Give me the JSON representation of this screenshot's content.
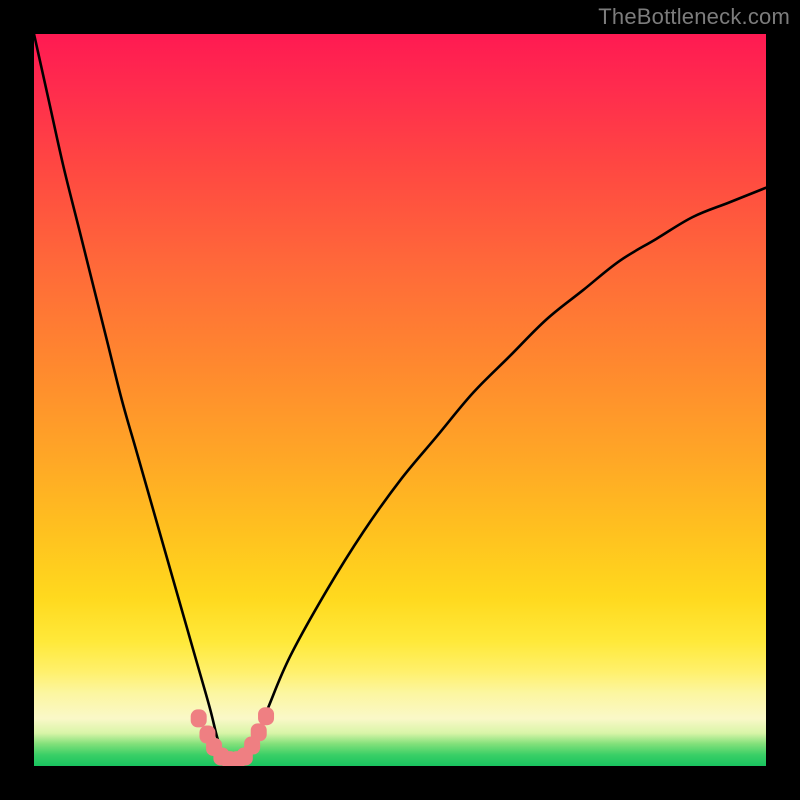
{
  "watermark": {
    "text": "TheBottleneck.com"
  },
  "chart_data": {
    "type": "line",
    "title": "",
    "xlabel": "",
    "ylabel": "",
    "xlim": [
      0,
      100
    ],
    "ylim": [
      0,
      100
    ],
    "grid": false,
    "legend": false,
    "series": [
      {
        "name": "bottleneck-curve",
        "x": [
          0,
          2,
          4,
          6,
          8,
          10,
          12,
          14,
          16,
          18,
          20,
          22,
          24,
          25,
          26,
          27,
          28,
          29,
          30,
          32,
          35,
          40,
          45,
          50,
          55,
          60,
          65,
          70,
          75,
          80,
          85,
          90,
          95,
          100
        ],
        "values": [
          100,
          91,
          82,
          74,
          66,
          58,
          50,
          43,
          36,
          29,
          22,
          15,
          8,
          4,
          1,
          0,
          0,
          1,
          3,
          8,
          15,
          24,
          32,
          39,
          45,
          51,
          56,
          61,
          65,
          69,
          72,
          75,
          77,
          79
        ]
      }
    ],
    "markers": [
      {
        "x": 22.5,
        "y": 6.5
      },
      {
        "x": 23.7,
        "y": 4.3
      },
      {
        "x": 24.6,
        "y": 2.6
      },
      {
        "x": 25.6,
        "y": 1.3
      },
      {
        "x": 26.7,
        "y": 0.8
      },
      {
        "x": 27.8,
        "y": 0.8
      },
      {
        "x": 28.8,
        "y": 1.3
      },
      {
        "x": 29.8,
        "y": 2.8
      },
      {
        "x": 30.7,
        "y": 4.6
      },
      {
        "x": 31.7,
        "y": 6.8
      }
    ],
    "gradient_background": {
      "top_color": "#ff1a52",
      "bottom_color": "#18c45f",
      "description": "vertical red-to-green heat gradient"
    }
  }
}
